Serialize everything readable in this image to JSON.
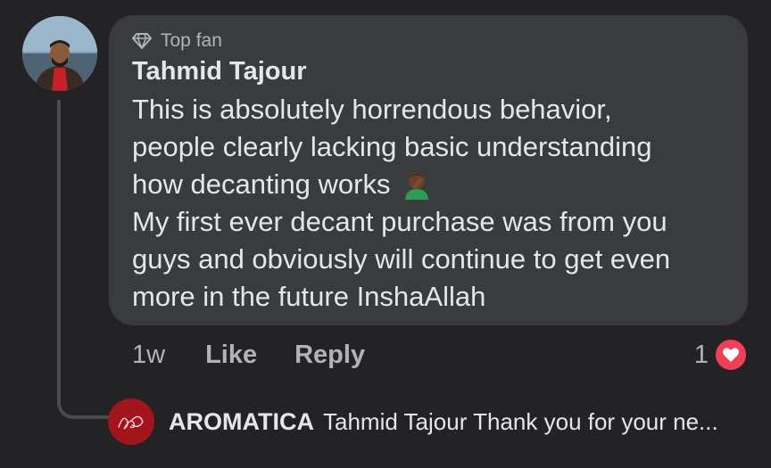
{
  "comment": {
    "badge": "Top fan",
    "author": "Tahmid Tajour",
    "body_lines": [
      "This is absolutely horrendous behavior,",
      "people clearly lacking basic understanding",
      "how decanting works",
      "My first ever decant purchase was from you",
      "guys and obviously will continue to get even",
      "more in the future InshaAllah"
    ],
    "emoji": "person-facepalming-icon",
    "time": "1w",
    "like_label": "Like",
    "reply_label": "Reply",
    "reaction_count": "1",
    "reaction_type": "heart-reaction-icon"
  },
  "reply": {
    "author": "AROMATICA",
    "preview": "Tahmid Tajour Thank you for your ne..."
  },
  "colors": {
    "background": "#232325",
    "bubble": "#3a3b3c",
    "heart": "#f33e58",
    "brand_avatar": "#a3141c"
  }
}
